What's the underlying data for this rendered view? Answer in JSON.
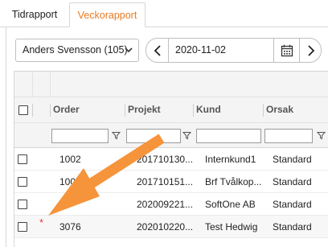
{
  "tabs": [
    {
      "label": "Tidrapport",
      "active": false
    },
    {
      "label": "Veckorapport",
      "active": true
    }
  ],
  "toolbar": {
    "employee_selected": "Anders Svensson (105)",
    "date_value": "2020-11-02"
  },
  "grid": {
    "columns": [
      "Order",
      "Projekt",
      "Kund",
      "Orsak"
    ],
    "rows": [
      {
        "order": "1002",
        "projekt": "201710130...",
        "kund": "Internkund1",
        "orsak": "Standard"
      },
      {
        "order": "1003",
        "projekt": "201710151...",
        "kund": "Brf Tvålkop...",
        "orsak": "Standard"
      },
      {
        "order": "2",
        "projekt": "202009221...",
        "kund": "SoftOne AB",
        "orsak": "Standard"
      },
      {
        "order": "3076",
        "projekt": "202010220...",
        "kund": "Test Hedwig",
        "orsak": "Standard"
      }
    ],
    "new_row_marker": "*"
  },
  "colors": {
    "accent": "#e87a22",
    "arrow": "#f5943a",
    "marker": "#e23b3b"
  },
  "icons": [
    "chevron-down-icon",
    "chevron-left-icon",
    "chevron-right-icon",
    "calendar-icon",
    "filter-icon",
    "arrow-annotation"
  ]
}
